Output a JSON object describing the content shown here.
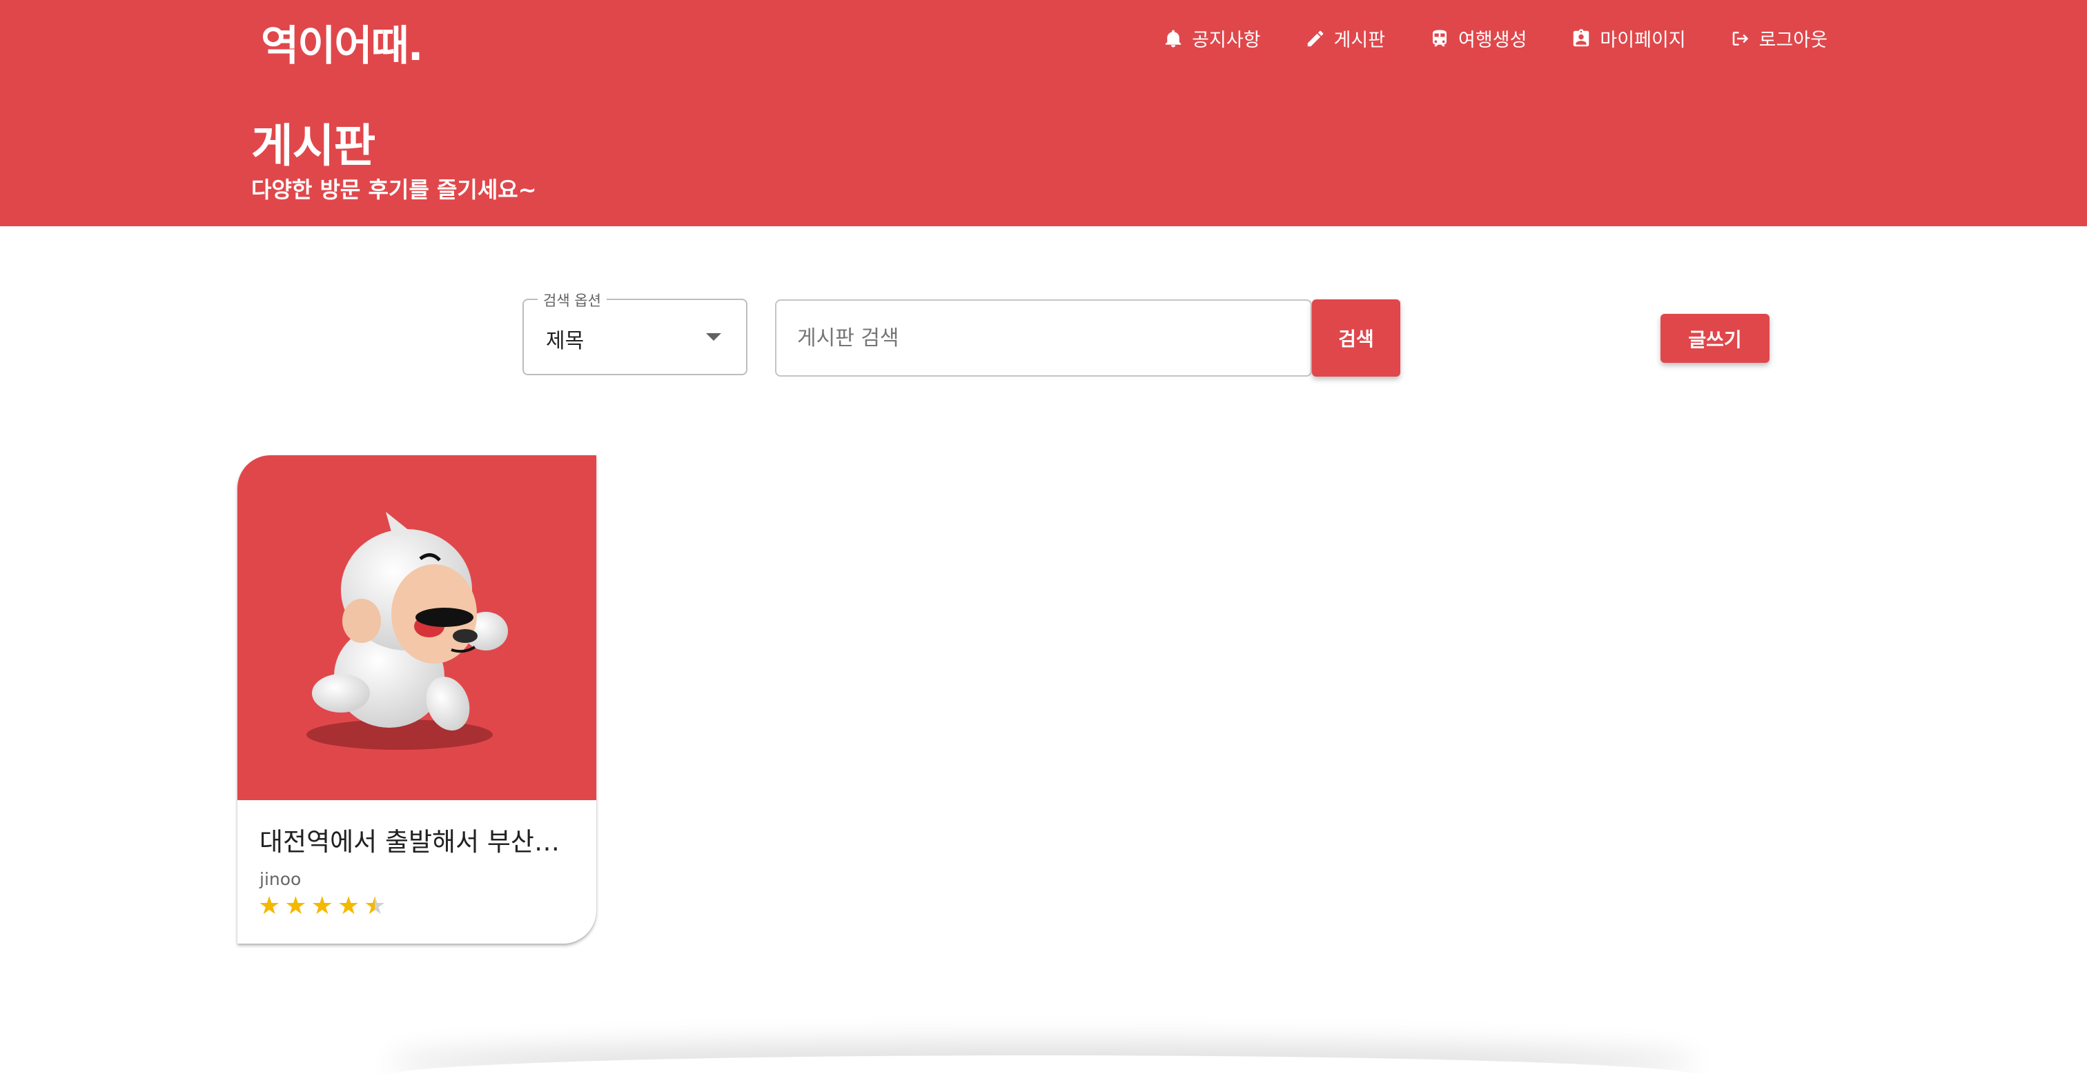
{
  "brand": {
    "logo": "역이어때."
  },
  "nav": [
    {
      "label": "공지사항",
      "icon": "bell-icon"
    },
    {
      "label": "게시판",
      "icon": "pencil-icon"
    },
    {
      "label": "여행생성",
      "icon": "train-icon"
    },
    {
      "label": "마이페이지",
      "icon": "id-badge-icon"
    },
    {
      "label": "로그아웃",
      "icon": "logout-icon"
    }
  ],
  "header": {
    "title": "게시판",
    "subtitle": "다양한 방문 후기를 즐기세요~"
  },
  "search": {
    "option_label": "검색 옵션",
    "option_value": "제목",
    "placeholder": "게시판 검색",
    "button": "검색"
  },
  "write_button": "글쓰기",
  "posts": [
    {
      "title": "대전역에서 출발해서 부산…",
      "author": "jinoo",
      "rating": 4.5,
      "image": "white-monkey-mascot"
    }
  ],
  "colors": {
    "brand": "#e0474b",
    "star": "#f5b800"
  }
}
